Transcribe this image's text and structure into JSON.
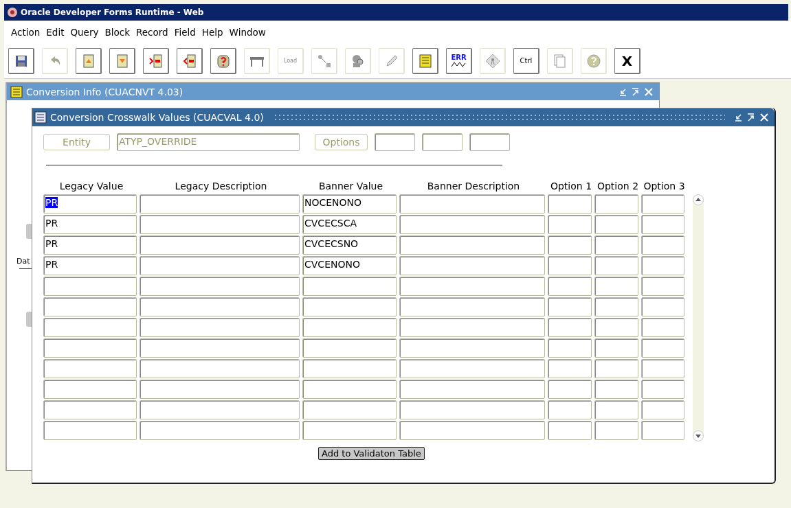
{
  "window": {
    "title": "Oracle Developer Forms Runtime - Web"
  },
  "menu": [
    "Action",
    "Edit",
    "Query",
    "Block",
    "Record",
    "Field",
    "Help",
    "Window"
  ],
  "toolbar": [
    {
      "kind": "save",
      "disabled": false
    },
    {
      "kind": "undo",
      "disabled": true
    },
    {
      "kind": "up",
      "disabled": false
    },
    {
      "kind": "down",
      "disabled": false
    },
    {
      "kind": "insert",
      "disabled": false
    },
    {
      "kind": "remove",
      "disabled": false
    },
    {
      "kind": "query",
      "disabled": false
    },
    {
      "kind": "table",
      "disabled": true
    },
    {
      "kind": "text",
      "label": "Load",
      "disabled": true
    },
    {
      "kind": "connector",
      "disabled": true
    },
    {
      "kind": "figure",
      "disabled": true
    },
    {
      "kind": "pencil",
      "disabled": true
    },
    {
      "kind": "scroll",
      "disabled": false
    },
    {
      "kind": "err",
      "label": "ERR",
      "disabled": false
    },
    {
      "kind": "diamond",
      "disabled": true
    },
    {
      "kind": "text",
      "label": "Ctrl",
      "disabled": false
    },
    {
      "kind": "pages",
      "disabled": true
    },
    {
      "kind": "help",
      "disabled": true
    },
    {
      "kind": "text",
      "label": "X",
      "disabled": false
    }
  ],
  "outer_window": {
    "title": "Conversion Info (CUACNVT 4.03)",
    "partial_label": "Dat"
  },
  "inner_window": {
    "title": "Conversion Crosswalk Values (CUACVAL 4.0)",
    "entity_label": "Entity",
    "entity_value": "ATYP_OVERRIDE",
    "options_label": "Options",
    "columns": [
      "Legacy Value",
      "Legacy Description",
      "Banner Value",
      "Banner Description",
      "Option 1",
      "Option 2",
      "Option 3"
    ],
    "rows": [
      {
        "legacy_value": "PR",
        "banner_value": "NOCENONO",
        "selected": true
      },
      {
        "legacy_value": "PR",
        "banner_value": "CVCECSCA",
        "selected": false
      },
      {
        "legacy_value": "PR",
        "banner_value": "CVCECSNO",
        "selected": false
      },
      {
        "legacy_value": "PR",
        "banner_value": "CVCENONO",
        "selected": false
      },
      {
        "selected": false
      },
      {
        "selected": false
      },
      {
        "selected": false
      },
      {
        "selected": false
      },
      {
        "selected": false
      },
      {
        "selected": false
      },
      {
        "selected": false
      },
      {
        "selected": false
      }
    ],
    "button": "Add to Validaton Table"
  }
}
